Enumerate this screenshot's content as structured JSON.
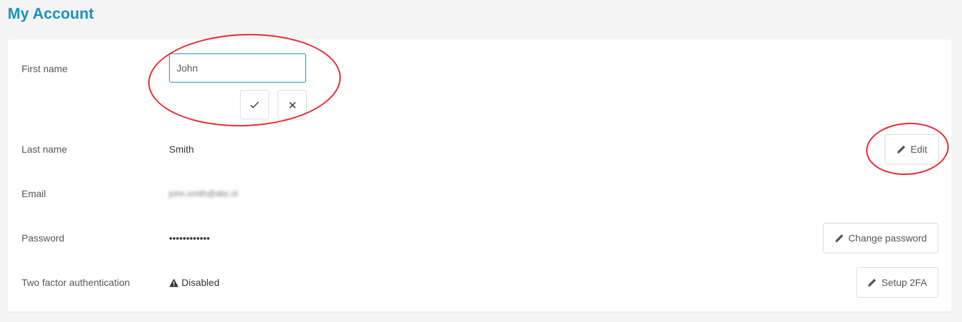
{
  "page": {
    "title": "My Account"
  },
  "fields": {
    "first_name": {
      "label": "First name",
      "value": "John"
    },
    "last_name": {
      "label": "Last name",
      "value": "Smith",
      "action": "Edit"
    },
    "email": {
      "label": "Email",
      "value": "john.smith@abc.nl"
    },
    "password": {
      "label": "Password",
      "value": "••••••••••••",
      "action": "Change password"
    },
    "two_factor": {
      "label": "Two factor authentication",
      "status": "Disabled",
      "action": "Setup 2FA"
    }
  },
  "icons": {
    "confirm": "check-icon",
    "cancel": "close-icon",
    "edit": "pencil-icon",
    "warning": "warning-icon"
  },
  "colors": {
    "accent": "#1a93bd",
    "annotation": "#e8272d",
    "background": "#f4f4f4"
  }
}
